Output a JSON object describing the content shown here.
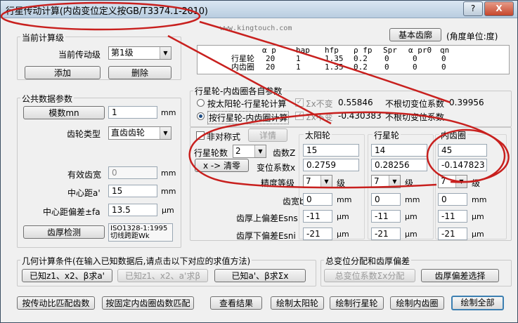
{
  "window": {
    "title": "行星传动计算(内齿变位定义按GB/T3374.1-2010)",
    "help_button": "?",
    "close_button": "X",
    "watermark": "www.kingtouch.com"
  },
  "toolbar": {
    "basic_rack_button": "基本齿廓",
    "angle_unit_note": "(角度单位:度)"
  },
  "current_stage": {
    "group_title": "当前计算级",
    "stage_label": "当前传动级",
    "stage_value": "第1级",
    "add_button": "添加",
    "delete_button": "删除"
  },
  "common": {
    "group_title": "公共数据参数",
    "module_button": "模数mn",
    "module_value": "1",
    "module_unit": "mm",
    "gear_type_label": "齿轮类型",
    "gear_type_value": "直齿齿轮",
    "effective_width_label": "有效齿宽",
    "effective_width_value": "0",
    "effective_width_unit": "mm",
    "center_distance_label": "中心距a'",
    "center_distance_value": "15",
    "center_distance_unit": "mm",
    "center_dev_label": "中心距偏差±fa",
    "center_dev_value": "13.5",
    "center_dev_unit": "μm",
    "tooth_thickness_button": "齿厚检测",
    "tooth_thickness_value": "ISO1328-1:1995\n切线跨距Wk"
  },
  "summary_table": {
    "headers": [
      "α p",
      "hap",
      "hfp",
      "ρ fp",
      "Spr",
      "α pr0",
      "qn"
    ],
    "rows": [
      {
        "name": "行星轮",
        "values": [
          "20",
          "1",
          "1.35",
          "0.2",
          "0",
          "0",
          "0"
        ]
      },
      {
        "name": "内齿圈",
        "values": [
          "20",
          "1",
          "1.35",
          "0.2",
          "0",
          "0",
          "0"
        ]
      }
    ]
  },
  "pairs": {
    "group_title": "行星轮-内齿圈各自参数",
    "option1_label": "按太阳轮-行星轮计算",
    "option1_sigma_label": "Σx不变",
    "option1_sigma_value": "0.55846",
    "option1_undercut_label": "不根切变位系数",
    "option1_undercut_value": "0.39956",
    "option2_label": "按行星轮-内齿圈计算",
    "option2_sigma_label": "Σx不变",
    "option2_sigma_value": "-0.430383",
    "option2_undercut_label": "不根切变位系数"
  },
  "gear_params": {
    "asym_label": "非对称式",
    "detail_button": "详情",
    "planet_count_label": "行星轮数",
    "planet_count_value": "2",
    "reset_button": "x -> 清零",
    "teeth_label": "齿数Z",
    "shift_label": "变位系数x",
    "accuracy_label": "精度等级",
    "width_label": "齿宽b",
    "upper_dev_label": "齿厚上偏差Esns",
    "lower_dev_label": "齿厚下偏差Esni",
    "grade_unit": "级",
    "width_unit": "mm",
    "dev_unit": "μm",
    "columns": [
      {
        "title": "太阳轮",
        "teeth": "15",
        "shift": "0.2759",
        "accuracy": "7",
        "width": "0",
        "upper": "-11",
        "lower": "-21"
      },
      {
        "title": "行星轮",
        "teeth": "14",
        "shift": "0.28256",
        "accuracy": "7",
        "width": "0",
        "upper": "-11",
        "lower": "-21"
      },
      {
        "title": "内齿圈",
        "teeth": "45",
        "shift": "-0.147823",
        "accuracy": "7",
        "width": "0",
        "upper": "-11",
        "lower": "-21"
      }
    ]
  },
  "geometry_conditions": {
    "group_title": "几何计算条件(在输入已知数据后,请点击以下对应的求值方法)",
    "button1": "已知z1、x2、β求a'",
    "button2": "已知z1、x2、a'求β",
    "button3": "已知a'、β求Σx"
  },
  "shift_distribution": {
    "group_title": "总变位分配和齿厚偏差",
    "button1": "总变位系数Σx分配",
    "button2": "齿厚偏差选择"
  },
  "bottom_buttons": [
    "按传动比匹配齿数",
    "按固定内齿圈齿数匹配",
    "查看结果",
    "绘制太阳轮",
    "绘制行星轮",
    "绘制内齿圈",
    "绘制全部"
  ],
  "colors": {
    "annotation": "#c8201e",
    "title_gradient_top": "#d9e6f2",
    "title_gradient_bottom": "#b9cde0",
    "default_button_border": "#3c7fb1"
  }
}
